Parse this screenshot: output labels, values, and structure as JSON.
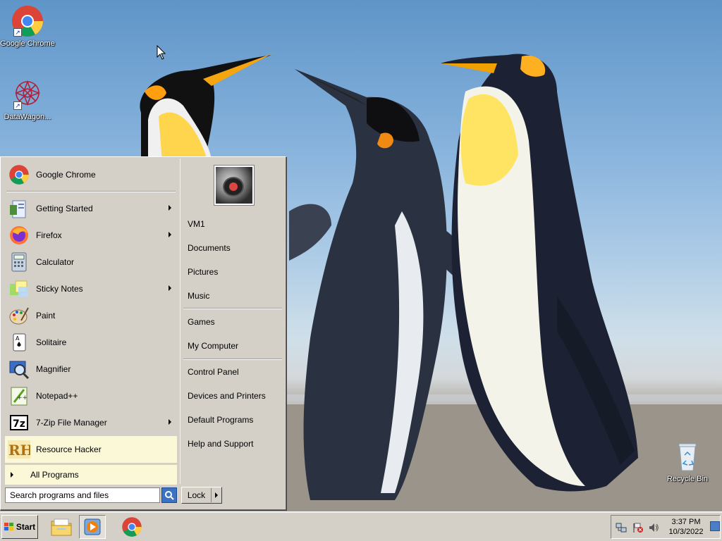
{
  "desktop": {
    "icons": [
      {
        "label": "Google Chrome",
        "icon": "chrome-icon"
      },
      {
        "label": "DataWagon...",
        "icon": "datawagon-icon"
      },
      {
        "label": "Recycle Bin",
        "icon": "recycle-bin-icon"
      }
    ]
  },
  "start_menu": {
    "pinned": [
      {
        "label": "Google Chrome",
        "icon": "chrome-icon"
      }
    ],
    "recent": [
      {
        "label": "Getting Started",
        "icon": "getting-started-icon",
        "submenu": true
      },
      {
        "label": "Firefox",
        "icon": "firefox-icon",
        "submenu": true
      },
      {
        "label": "Calculator",
        "icon": "calculator-icon",
        "submenu": false
      },
      {
        "label": "Sticky Notes",
        "icon": "sticky-notes-icon",
        "submenu": true
      },
      {
        "label": "Paint",
        "icon": "paint-icon",
        "submenu": false
      },
      {
        "label": "Solitaire",
        "icon": "solitaire-icon",
        "submenu": false
      },
      {
        "label": "Magnifier",
        "icon": "magnifier-icon",
        "submenu": false
      },
      {
        "label": "Notepad++",
        "icon": "notepad-plus-plus-icon",
        "submenu": false
      },
      {
        "label": "7-Zip File Manager",
        "icon": "7zip-icon",
        "submenu": true
      },
      {
        "label": "Resource Hacker",
        "icon": "resource-hacker-icon",
        "submenu": false
      }
    ],
    "all_programs": "All Programs",
    "right": {
      "user": "VM1",
      "group1": [
        "Documents",
        "Pictures",
        "Music"
      ],
      "group2": [
        "Games",
        "My Computer"
      ],
      "group3": [
        "Control Panel",
        "Devices and Printers",
        "Default Programs",
        "Help and Support"
      ]
    },
    "search_placeholder": "Search programs and files",
    "lock_label": "Lock"
  },
  "taskbar": {
    "start_label": "Start",
    "apps": [
      {
        "name": "file-explorer",
        "icon": "folder-icon"
      },
      {
        "name": "media-player",
        "icon": "media-player-icon"
      },
      {
        "name": "chrome",
        "icon": "chrome-icon"
      }
    ],
    "clock_time": "3:37 PM",
    "clock_date": "10/3/2022"
  },
  "colors": {
    "menu_bg": "#d4d0c8",
    "highlight": "#fbf8d8",
    "sky": "#86b2dc"
  }
}
